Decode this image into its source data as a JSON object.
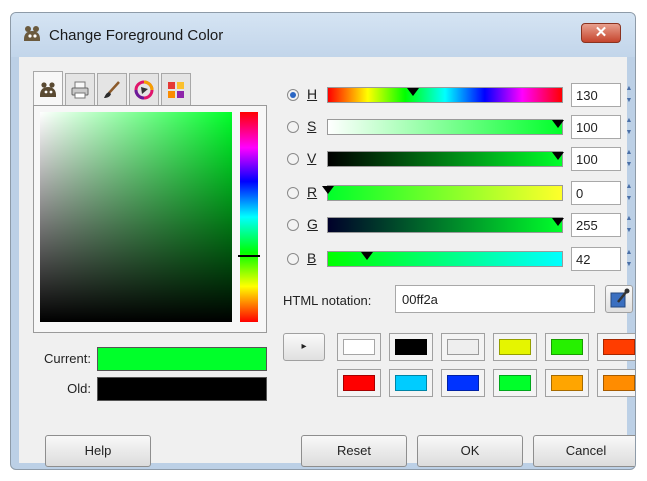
{
  "window": {
    "title": "Change Foreground Color",
    "close_label": "✕"
  },
  "tabs": [
    {
      "icon": "gimp-wilber-icon",
      "active": true
    },
    {
      "icon": "printer-icon",
      "active": false
    },
    {
      "icon": "paintbrush-icon",
      "active": false
    },
    {
      "icon": "color-wheel-icon",
      "active": false
    },
    {
      "icon": "palette-icon",
      "active": false
    }
  ],
  "swatches": {
    "current_label": "Current:",
    "old_label": "Old:",
    "current_color": "#00ff2a",
    "old_color": "#000000"
  },
  "sliders": [
    {
      "label": "H",
      "value": "130",
      "selected": true
    },
    {
      "label": "S",
      "value": "100",
      "selected": false
    },
    {
      "label": "V",
      "value": "100",
      "selected": false
    },
    {
      "label": "R",
      "value": "0",
      "selected": false
    },
    {
      "label": "G",
      "value": "255",
      "selected": false
    },
    {
      "label": "B",
      "value": "42",
      "selected": false
    }
  ],
  "html_notation": {
    "label": "HTML notation:",
    "value": "00ff2a"
  },
  "history": {
    "arrow": "▸",
    "colors": [
      "#ffffff",
      "#000000",
      "#eeeeee",
      "#e5f500",
      "#26f000",
      "#ff3d00",
      "#ff0000",
      "#00ccff",
      "#0033ff",
      "#00ff2a",
      "#ffa500",
      "#ff8c00"
    ]
  },
  "buttons": {
    "help": "Help",
    "reset": "Reset",
    "ok": "OK",
    "cancel": "Cancel"
  }
}
